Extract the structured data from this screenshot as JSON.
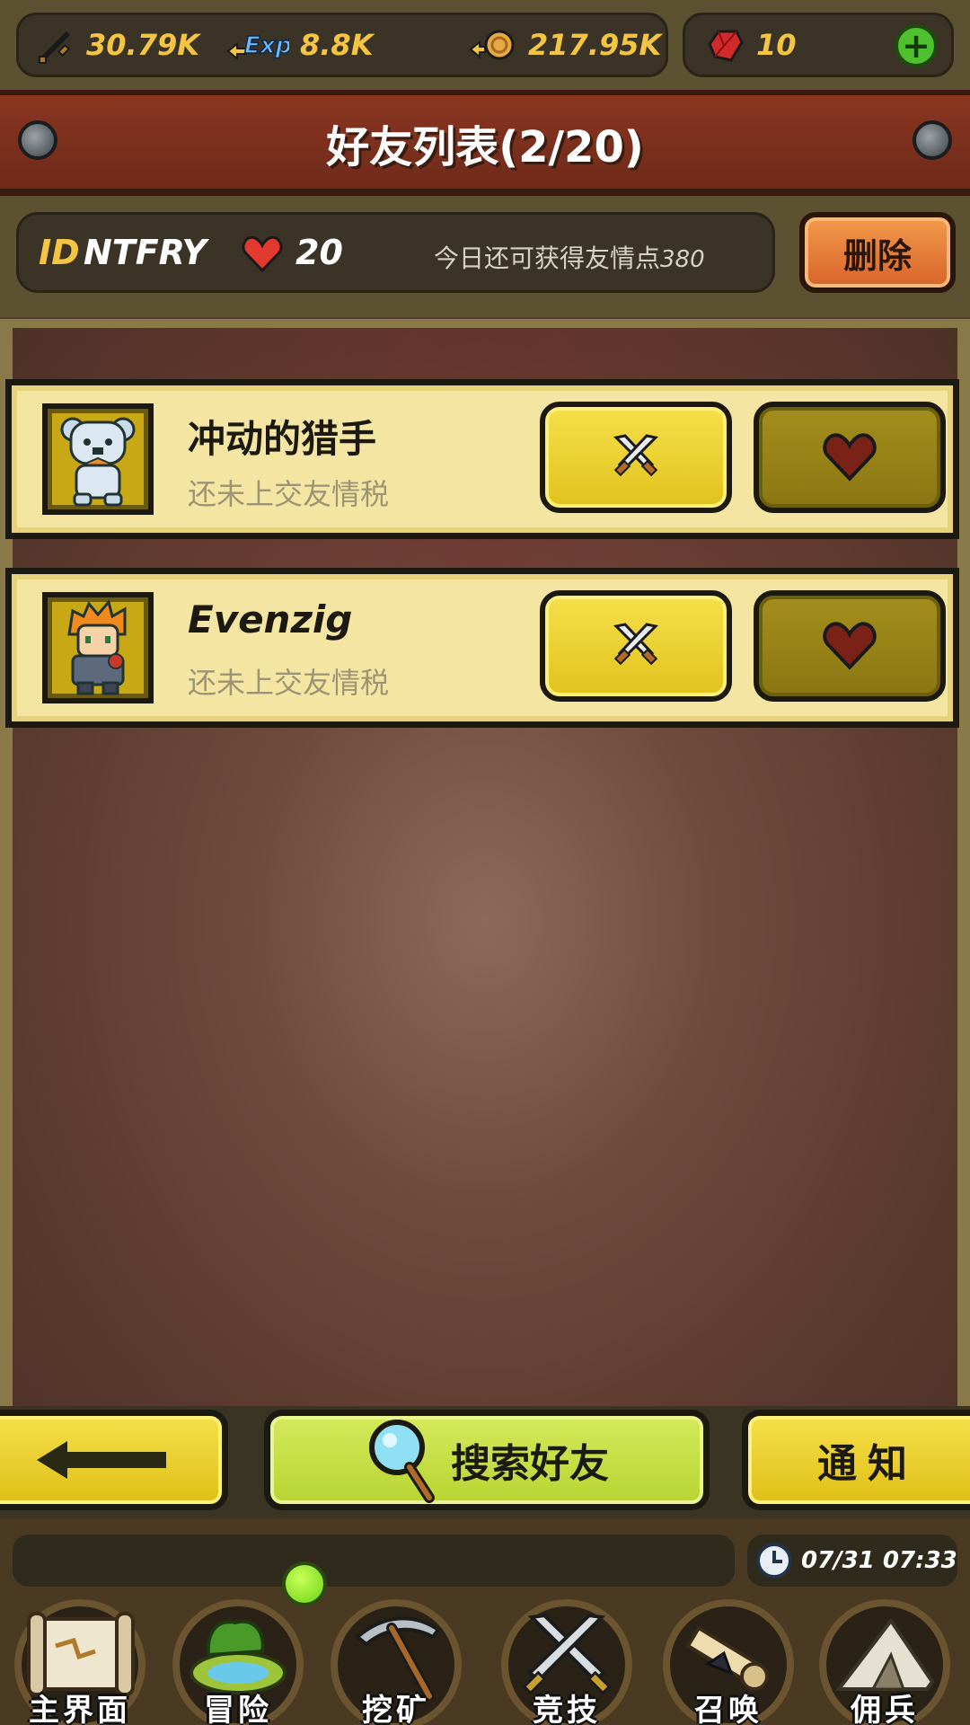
{
  "resources": {
    "attack": "30.79K",
    "exp_label": "Exp",
    "exp": "8.8K",
    "gold": "217.95K",
    "gems": "10",
    "add_symbol": "+"
  },
  "banner": {
    "title": "好友列表(2/20)"
  },
  "info": {
    "id_label": "ID",
    "id_value": "NTFRY",
    "hearts": "20",
    "friendship_text": "今日还可获得友情点",
    "friendship_points": "380",
    "delete_label": "删除"
  },
  "friends": [
    {
      "name": "冲动的猎手",
      "status": "还未上交友情税"
    },
    {
      "name": "Evenzig",
      "status": "还未上交友情税"
    }
  ],
  "actions": {
    "search_label": "搜索好友",
    "notify_label": "通知"
  },
  "status": {
    "datetime": "07/31 07:33"
  },
  "nav": [
    {
      "label": "主界面",
      "icon": "map-scroll-icon"
    },
    {
      "label": "冒险",
      "icon": "island-icon"
    },
    {
      "label": "挖矿",
      "icon": "pickaxe-icon"
    },
    {
      "label": "竞技",
      "icon": "crossed-swords-icon"
    },
    {
      "label": "召唤",
      "icon": "summon-scroll-icon"
    },
    {
      "label": "佣兵",
      "icon": "tent-icon"
    }
  ],
  "colors": {
    "accent_yellow": "#f4c542",
    "banner_red": "#8a3621",
    "card_bg": "#f4e6a2",
    "delete_orange": "#e07a38",
    "search_green": "#c6df44"
  }
}
